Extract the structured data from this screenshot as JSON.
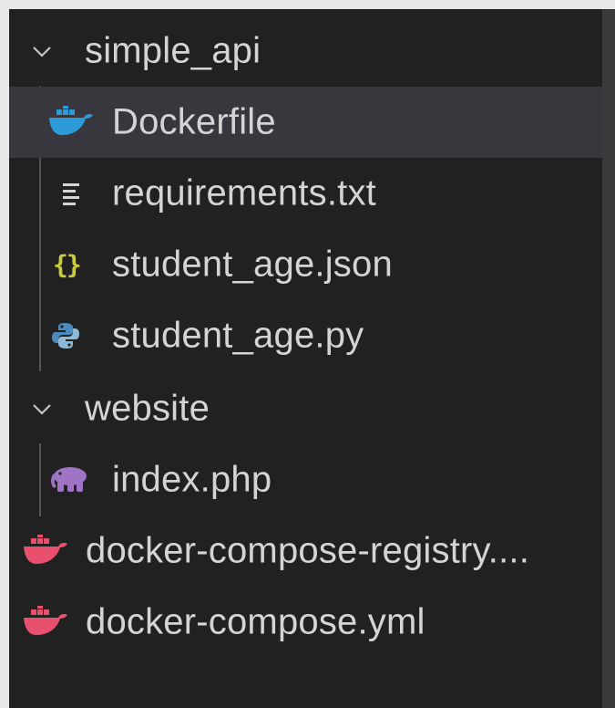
{
  "tree": {
    "folders": {
      "simple_api": {
        "label": "simple_api",
        "expanded": true,
        "files": [
          {
            "label": "Dockerfile",
            "icon": "docker-icon",
            "selected": true
          },
          {
            "label": "requirements.txt",
            "icon": "text-file-icon"
          },
          {
            "label": "student_age.json",
            "icon": "json-icon"
          },
          {
            "label": "student_age.py",
            "icon": "python-icon"
          }
        ]
      },
      "website": {
        "label": "website",
        "expanded": true,
        "files": [
          {
            "label": "index.php",
            "icon": "php-elephant-icon"
          }
        ]
      }
    },
    "root_files": [
      {
        "label": "docker-compose-registry....",
        "icon": "docker-compose-icon"
      },
      {
        "label": "docker-compose.yml",
        "icon": "docker-compose-icon"
      }
    ]
  },
  "colors": {
    "background": "#212121",
    "selected_row": "#37373d",
    "text": "#d4d4d4",
    "docker_blue": "#2d9bd8",
    "docker_pink": "#e8506e",
    "json_yellow": "#cbcb41",
    "python_blue": "#4b8bbe",
    "php_purple": "#a074c4"
  }
}
